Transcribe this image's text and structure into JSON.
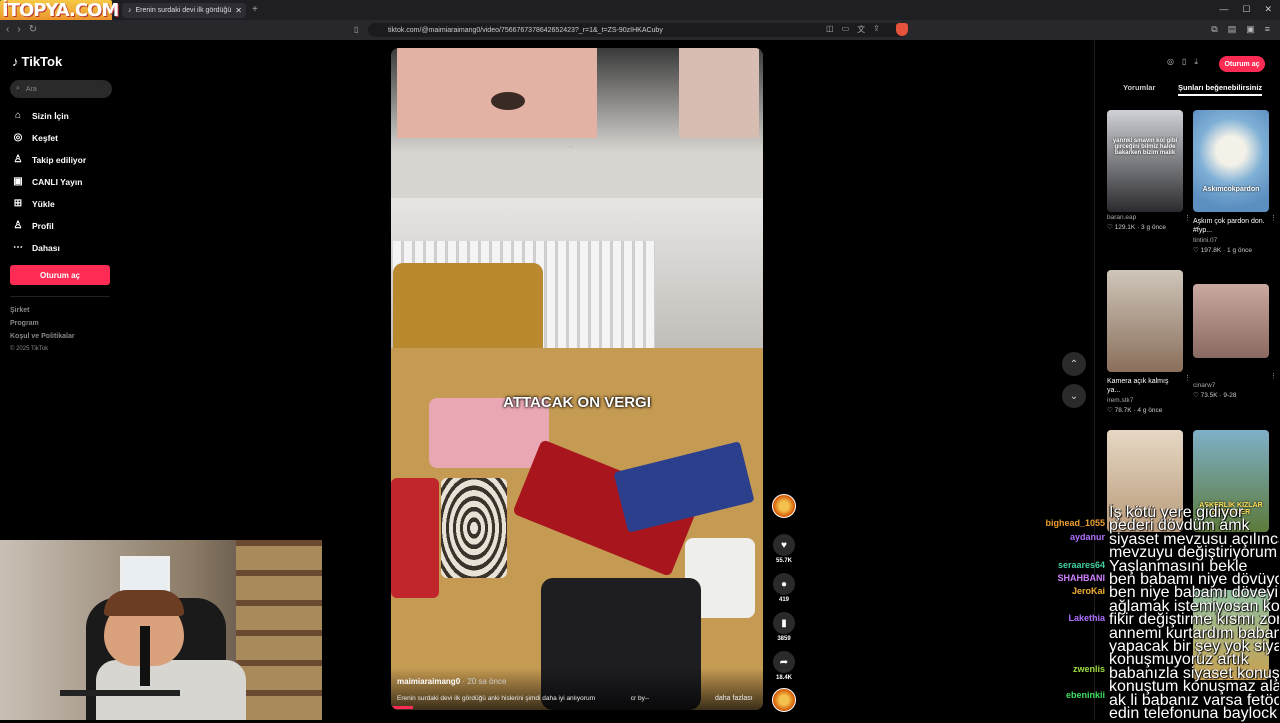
{
  "browser": {
    "watermark": "İTOPYA.COM",
    "tab_title": "Erenin surdaki devi ilk gördüğü",
    "url": "tiktok.com/@maimiaraimang0/video/7566767378642652423?_r=1&_t=ZS-90zIHKACuby"
  },
  "sidebar": {
    "logo": "TikTok",
    "search_placeholder": "Ara",
    "items": [
      {
        "label": "Sizin İçin",
        "icon": "home-icon"
      },
      {
        "label": "Keşfet",
        "icon": "compass-icon"
      },
      {
        "label": "Takip ediliyor",
        "icon": "following-icon"
      },
      {
        "label": "CANLI Yayın",
        "icon": "live-icon"
      },
      {
        "label": "Yükle",
        "icon": "upload-icon"
      },
      {
        "label": "Profil",
        "icon": "profile-icon"
      },
      {
        "label": "Dahası",
        "icon": "more-icon"
      }
    ],
    "login_button": "Oturum aç",
    "footer": [
      "Şirket",
      "Program",
      "Koşul ve Politikalar",
      "© 2025 TikTok"
    ]
  },
  "video": {
    "overlay_caption": "ATTACAK ON VERGI",
    "author": "maimiaraimang0",
    "time": "· 20 sa önce",
    "description": "Erenin surdaki devi ilk gördüğü anki hislerini şimdi daha iyi anlıyorum",
    "credit": "cr by--",
    "more": "daha fazlası",
    "progress": 0.06
  },
  "actions": {
    "likes": "55.7K",
    "comments": "419",
    "saves": "3859",
    "shares": "18.4K"
  },
  "right_panel": {
    "login_button": "Oturum aç",
    "tabs": [
      "Yorumlar",
      "Şunları beğenebilirsiniz"
    ],
    "active_tab": 1,
    "cards": [
      {
        "overlay": "yarınki sınavın kol gibi girceğini bilmiz halde bakarken bizim malik",
        "title": "",
        "user": "baran.eap",
        "likes": "129.1K",
        "time": "3 g önce"
      },
      {
        "overlay": "Askımcokpardon",
        "title": "Aşkım çok pardon don. #fyp...",
        "user": "tintini.07",
        "likes": "197.8K",
        "time": "1 g önce"
      },
      {
        "overlay": "",
        "title": "Kamera açık kalmış ya...",
        "user": "irem.stk7",
        "likes": "78.7K",
        "time": "4 g önce"
      },
      {
        "overlay": "",
        "title": "",
        "user": "cinarw7",
        "likes": "73.5K",
        "time": "9-28"
      },
      {
        "overlay": "",
        "title": "",
        "user": "",
        "likes": "",
        "time": ""
      },
      {
        "overlay": "ASKERLİK KIZLAR ERKEKLER",
        "title": "",
        "user": "",
        "likes": "",
        "time": ""
      }
    ]
  },
  "chat": [
    {
      "name": "bighead_1055",
      "color": "#f0a030",
      "msg": "İş kötü yere gidiyor"
    },
    {
      "name": "aydanur",
      "color": "#b070ff",
      "msg": "pederi dövdüm amk"
    },
    {
      "name": "seraares64",
      "color": "#40d0a0",
      "msg": "siyaset mevzusu açılınca direkt"
    },
    {
      "name": "SHAHBANI",
      "color": "#d080ff",
      "msg": "mevzuyu değiştiriyorum"
    },
    {
      "name": "JeroKai",
      "color": "#f0b030",
      "msg": "Yaşlanmasını bekle"
    },
    {
      "name": "Lakethia",
      "color": "#b070ff",
      "msg": "ben babamı niye dövüyorum ya"
    },
    {
      "name": "zwenlis",
      "color": "#9cdc40",
      "msg": "ben niye babamı döveyim"
    },
    {
      "name": "ebeninkii",
      "color": "#40e060",
      "msg": "ağlamak istemiyosan konuşma"
    }
  ],
  "chat_extra": [
    "fikir değiştirme kısmı zor",
    "annemi kurtardım babam kaldı",
    "yapacak bir şey yok siyaset",
    "konuşmuyoruz artık",
    "babanızla siyaset konuşmayın",
    "konuştum konuşmaz alaydım",
    "ak li babanız varsa fetöcü diye ihbar",
    "edin telefonuna baylock yükleyip"
  ]
}
